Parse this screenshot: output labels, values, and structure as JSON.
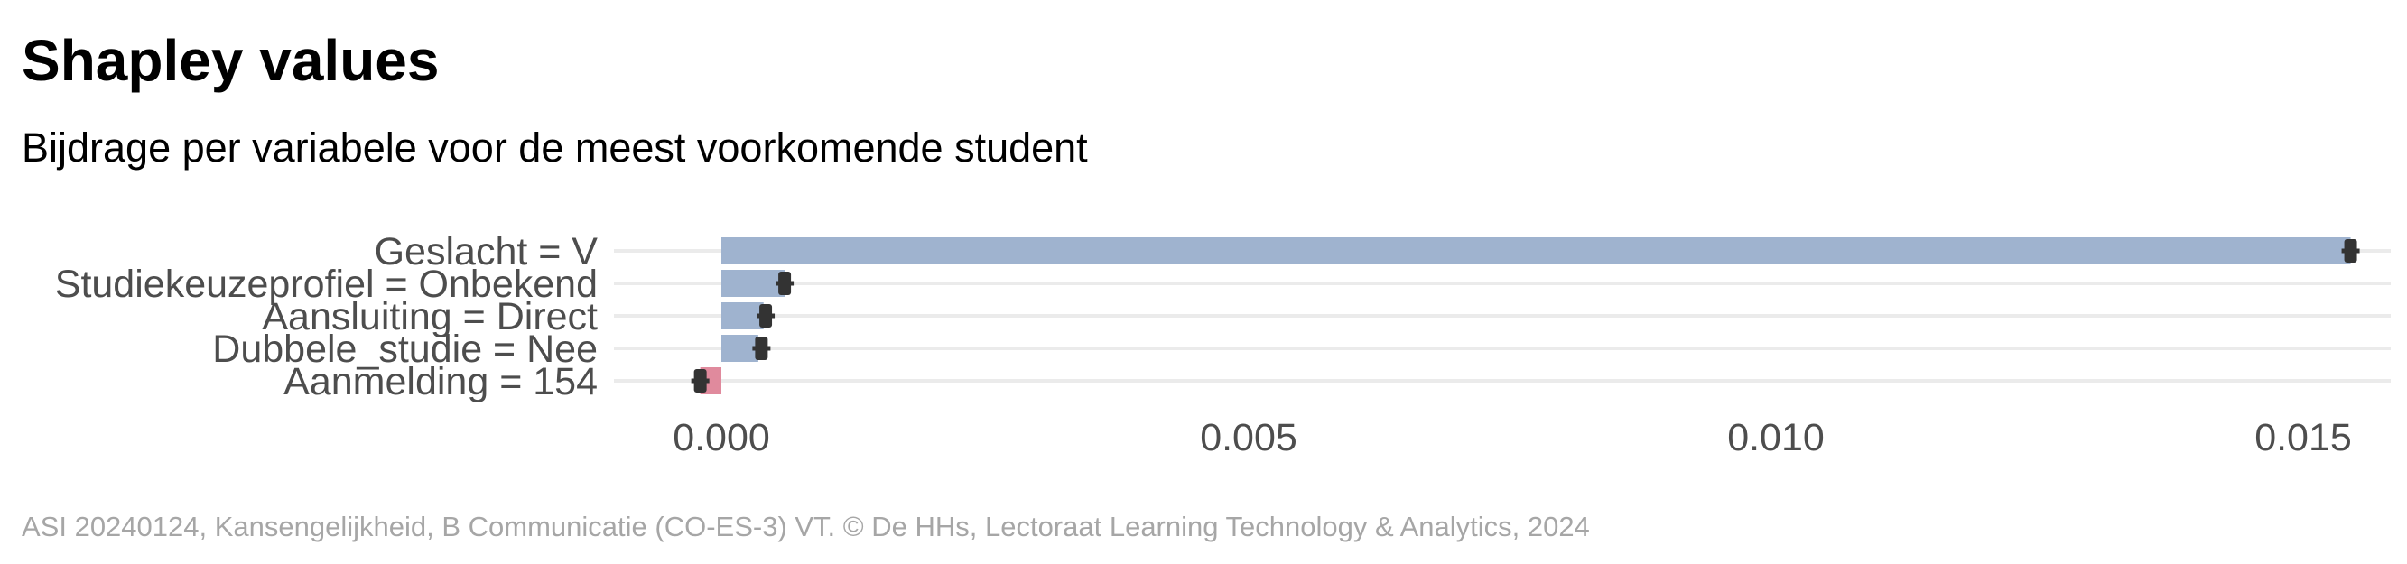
{
  "title": "Shapley values",
  "subtitle": "Bijdrage per variabele voor de meest voorkomende student",
  "caption": "ASI 20240124, Kansengelijkheid, B Communicatie (CO-ES-3) VT. © De HHs, Lectoraat Learning Technology & Analytics, 2024",
  "chart_data": {
    "type": "bar",
    "orientation": "horizontal",
    "title": "Shapley values",
    "subtitle": "Bijdrage per variabele voor de meest voorkomende student",
    "xlabel": "",
    "ylabel": "",
    "categories": [
      "Geslacht = V",
      "Studiekeuzeprofiel = Onbekend",
      "Aansluiting = Direct",
      "Dubbele_studie = Nee",
      "Aanmelding = 154"
    ],
    "values": [
      0.01545,
      0.0006,
      0.0004,
      0.00035,
      -0.0002
    ],
    "error_center": [
      0.01545,
      0.0006,
      0.00042,
      0.00038,
      -0.0002
    ],
    "x_ticks": [
      "0.000",
      "0.005",
      "0.010",
      "0.015"
    ],
    "x_tick_values": [
      0,
      0.005,
      0.01,
      0.015
    ],
    "xlim": [
      -0.001,
      0.0163
    ],
    "grid": true,
    "colors": {
      "positive": "#9fb3cf",
      "negative": "#e08a9d",
      "marker": "#333333",
      "grid": "#ebebeb"
    }
  }
}
